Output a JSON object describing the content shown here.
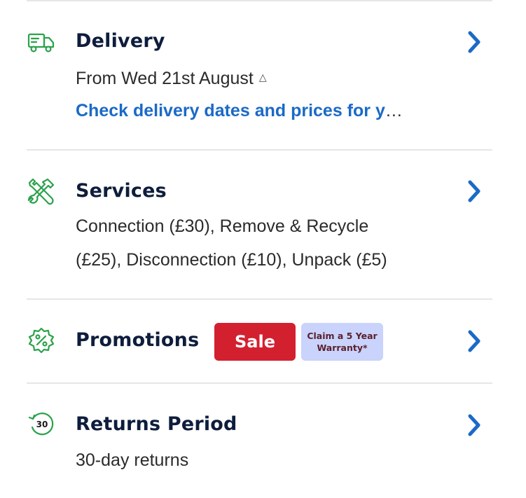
{
  "colors": {
    "accent_green": "#2aa24a",
    "link_blue": "#1b6ac6",
    "chevron_blue": "#1b6ac6",
    "title_navy": "#0e1d3c",
    "sale_red": "#d3202f",
    "warranty_bg": "#c9d3fb"
  },
  "delivery": {
    "icon": "delivery-truck-icon",
    "title": "Delivery",
    "subtitle": "From Wed 21st August",
    "info_glyph": "△",
    "link": "Check delivery dates and prices for y",
    "ellipsis": "…"
  },
  "services": {
    "icon": "wrench-icon",
    "title": "Services",
    "line1": "Connection (£30), Remove & Recycle",
    "line2": "(£25), Disconnection (£10), Unpack (£5)"
  },
  "promotions": {
    "icon": "percent-badge-icon",
    "title": "Promotions",
    "sale_label": "Sale",
    "warranty_line1": "Claim a 5 Year",
    "warranty_line2": "Warranty*"
  },
  "returns": {
    "icon": "returns-30-icon",
    "icon_text": "30",
    "title": "Returns Period",
    "subtitle": "30-day returns"
  }
}
